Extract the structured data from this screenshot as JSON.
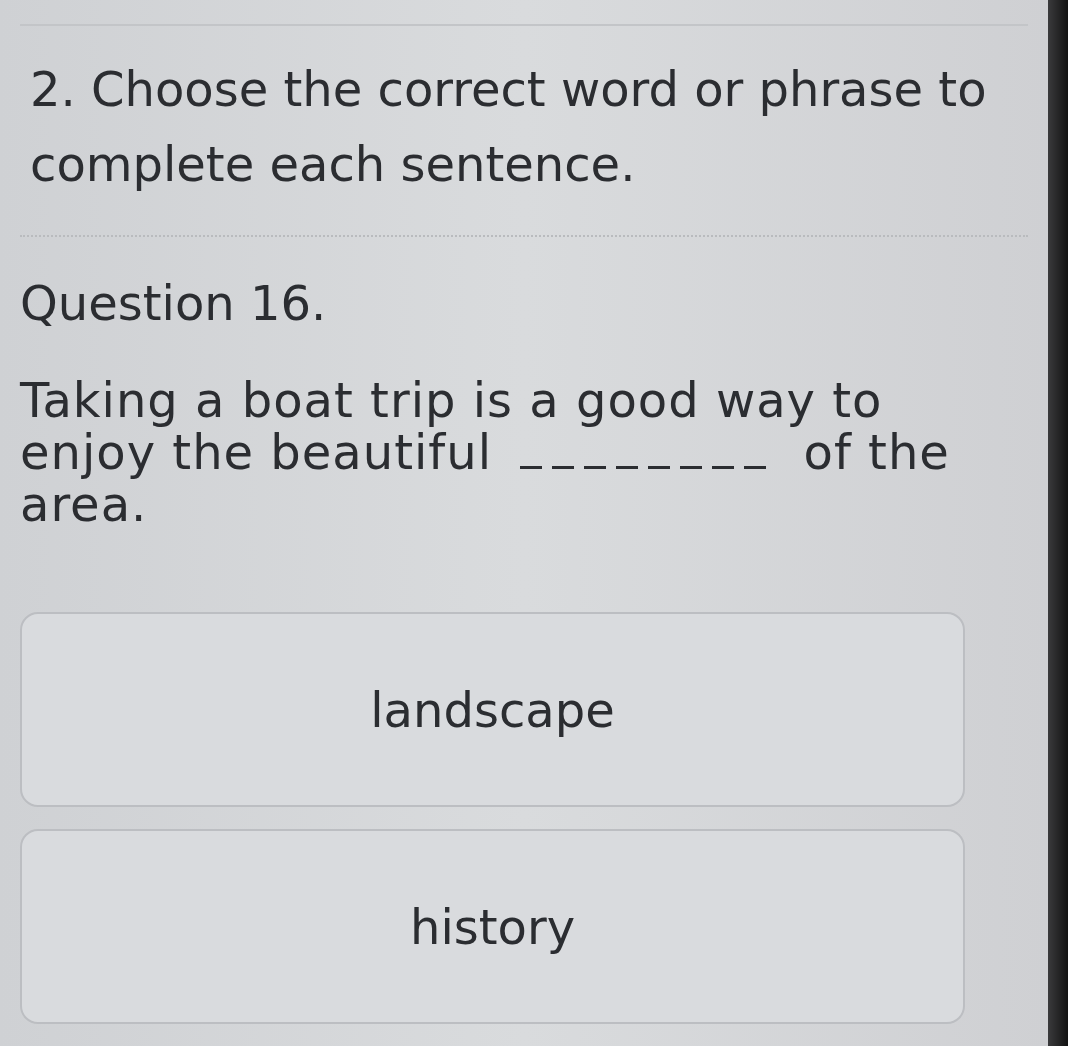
{
  "instruction": "2. Choose the correct word or phrase to complete each sentence.",
  "question": {
    "label": "Question 16.",
    "text_before": "Taking a boat trip is a good way to enjoy the beautiful",
    "text_after": "of the area."
  },
  "options": [
    {
      "label": "landscape",
      "selected": false
    },
    {
      "label": "history",
      "selected": false
    }
  ]
}
